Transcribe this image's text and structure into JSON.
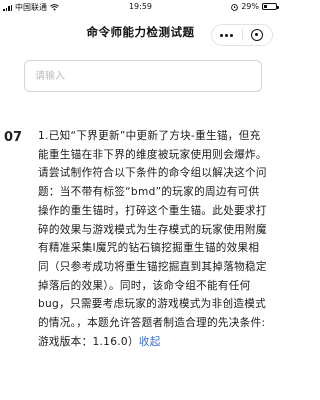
{
  "status_bar": {
    "carrier": "中国联通",
    "time": "19:59",
    "battery_percent": "29%",
    "battery_level": 0.29
  },
  "navbar": {
    "title": "命令师能力检测试题"
  },
  "search": {
    "placeholder": "请输入"
  },
  "question": {
    "number": "07",
    "text": "1.已知“下界更新”中更新了方块-重生锚，但充能重生锚在非下界的维度被玩家使用则会爆炸。请尝试制作符合以下条件的命令组以解决这个问题：当不带有标签“bmd”的玩家的周边有可供操作的重生锚时，打碎这个重生锚。此处要求打碎的效果与游戏模式为生存模式的玩家使用附魔有精准采集Ⅰ魔咒的钻石镐挖掘重生锚的效果相同（只参考成功将重生锚挖掘直到其掉落物稳定掉落后的效果）。同时，该命令组不能有任何bug，只需要考虑玩家的游戏模式为非创造模式的情况。，本题允许答题者制造合理的先决条件:游戏版本：1.16.0）",
    "collapse_label": "收起"
  }
}
